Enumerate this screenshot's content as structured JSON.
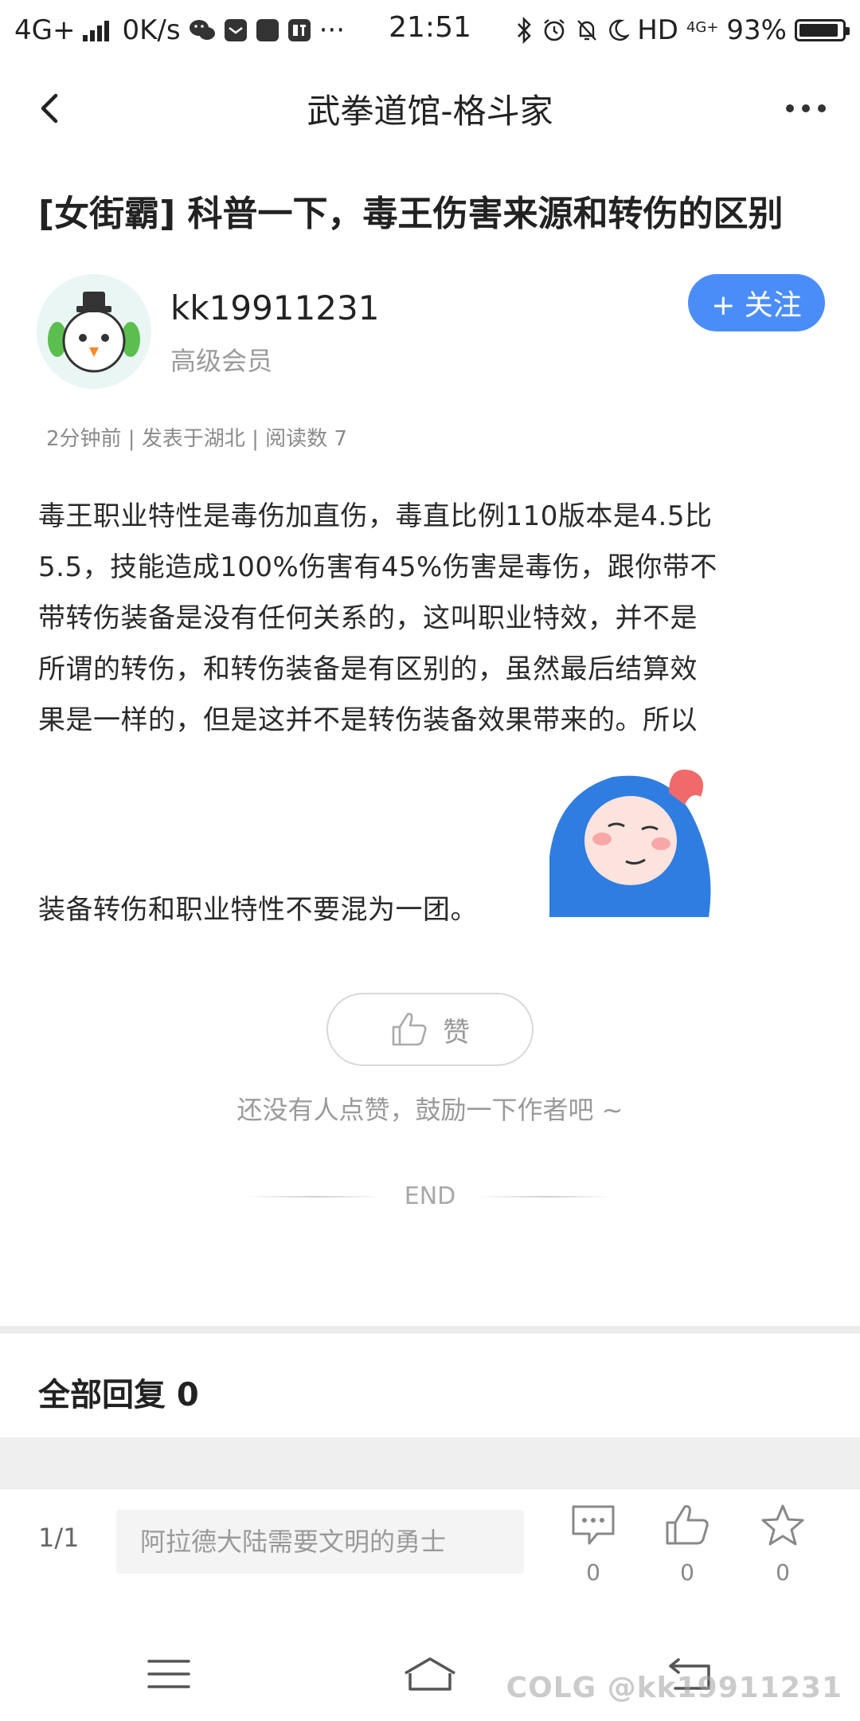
{
  "status_bar": {
    "network": "4G+",
    "speed": "0K/s",
    "time": "21:51",
    "hd": "HD",
    "network_badge": "4G+",
    "battery": "93%",
    "battery_level": 0.93
  },
  "nav": {
    "title": "武拳道馆-格斗家"
  },
  "post": {
    "title": "[女街霸] 科普一下，毒王伤害来源和转伤的区别",
    "author": {
      "name": "kk19911231",
      "level": "高级会员"
    },
    "follow_label": "+ 关注",
    "meta": "2分钟前 | 发表于湖北 | 阅读数 7",
    "body_lines": [
      "毒王职业特性是毒伤加直伤，毒直比例110版本是4.5比",
      "5.5，技能造成100%伤害有45%伤害是毒伤，跟你带不",
      "带转伤装备是没有任何关系的，这叫职业特效，并不是",
      "所谓的转伤，和转伤装备是有区别的，虽然最后结算效",
      "果是一样的，但是这并不是转伤装备效果带来的。所以"
    ],
    "last_line": "装备转伤和职业特性不要混为一团。",
    "like_label": "赞",
    "like_hint": "还没有人点赞，鼓励一下作者吧 ~",
    "end_label": "END"
  },
  "replies": {
    "title": "全部回复  0"
  },
  "action_bar": {
    "page": "1/1",
    "input_placeholder": "阿拉德大陆需要文明的勇士",
    "comment_count": "0",
    "like_count": "0",
    "favorite_count": "0"
  },
  "watermark": "COLG @kk19911231",
  "colors": {
    "accent": "#4b8df8",
    "sticker_blue": "#2f7de1",
    "sticker_pink": "#f06a6a"
  }
}
